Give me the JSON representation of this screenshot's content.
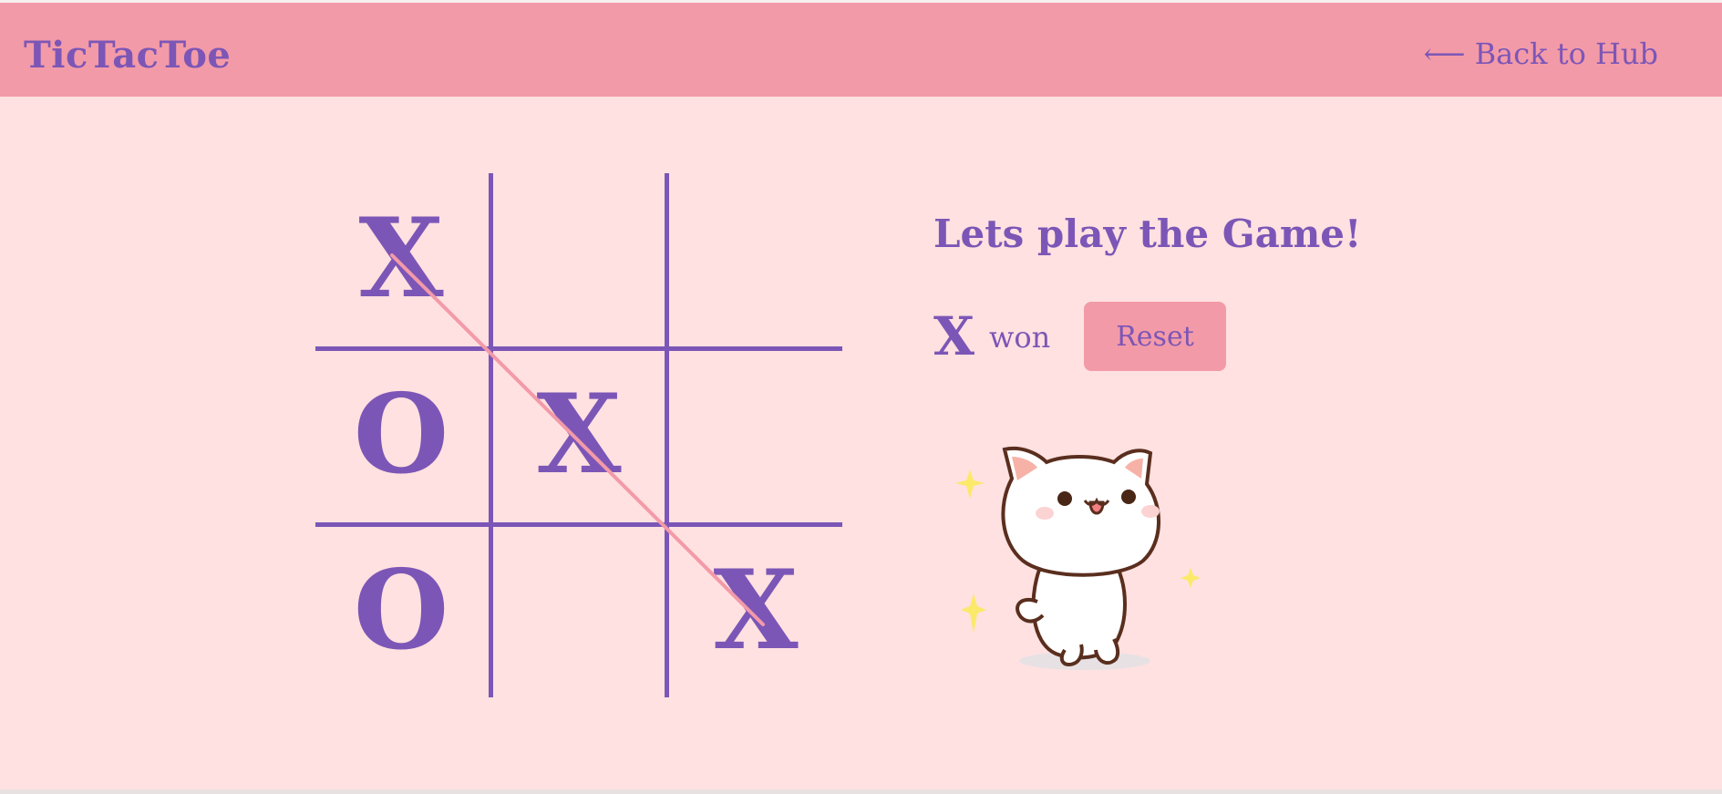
{
  "header": {
    "brand": "TicTacToe",
    "back_link": "⟵ Back to Hub"
  },
  "game": {
    "board": [
      "X",
      "",
      "",
      "O",
      "X",
      "",
      "O",
      "",
      "X"
    ],
    "winning_line": [
      0,
      4,
      8
    ],
    "title": "Lets play the Game!",
    "winner": "X",
    "won_text": "won",
    "reset_label": "Reset"
  },
  "colors": {
    "background": "#ffe1e1",
    "header": "#f39aa8",
    "accent": "#7c56b6",
    "win_line": "#f39aa8"
  },
  "image": {
    "icon": "happy-cat-sticker"
  }
}
